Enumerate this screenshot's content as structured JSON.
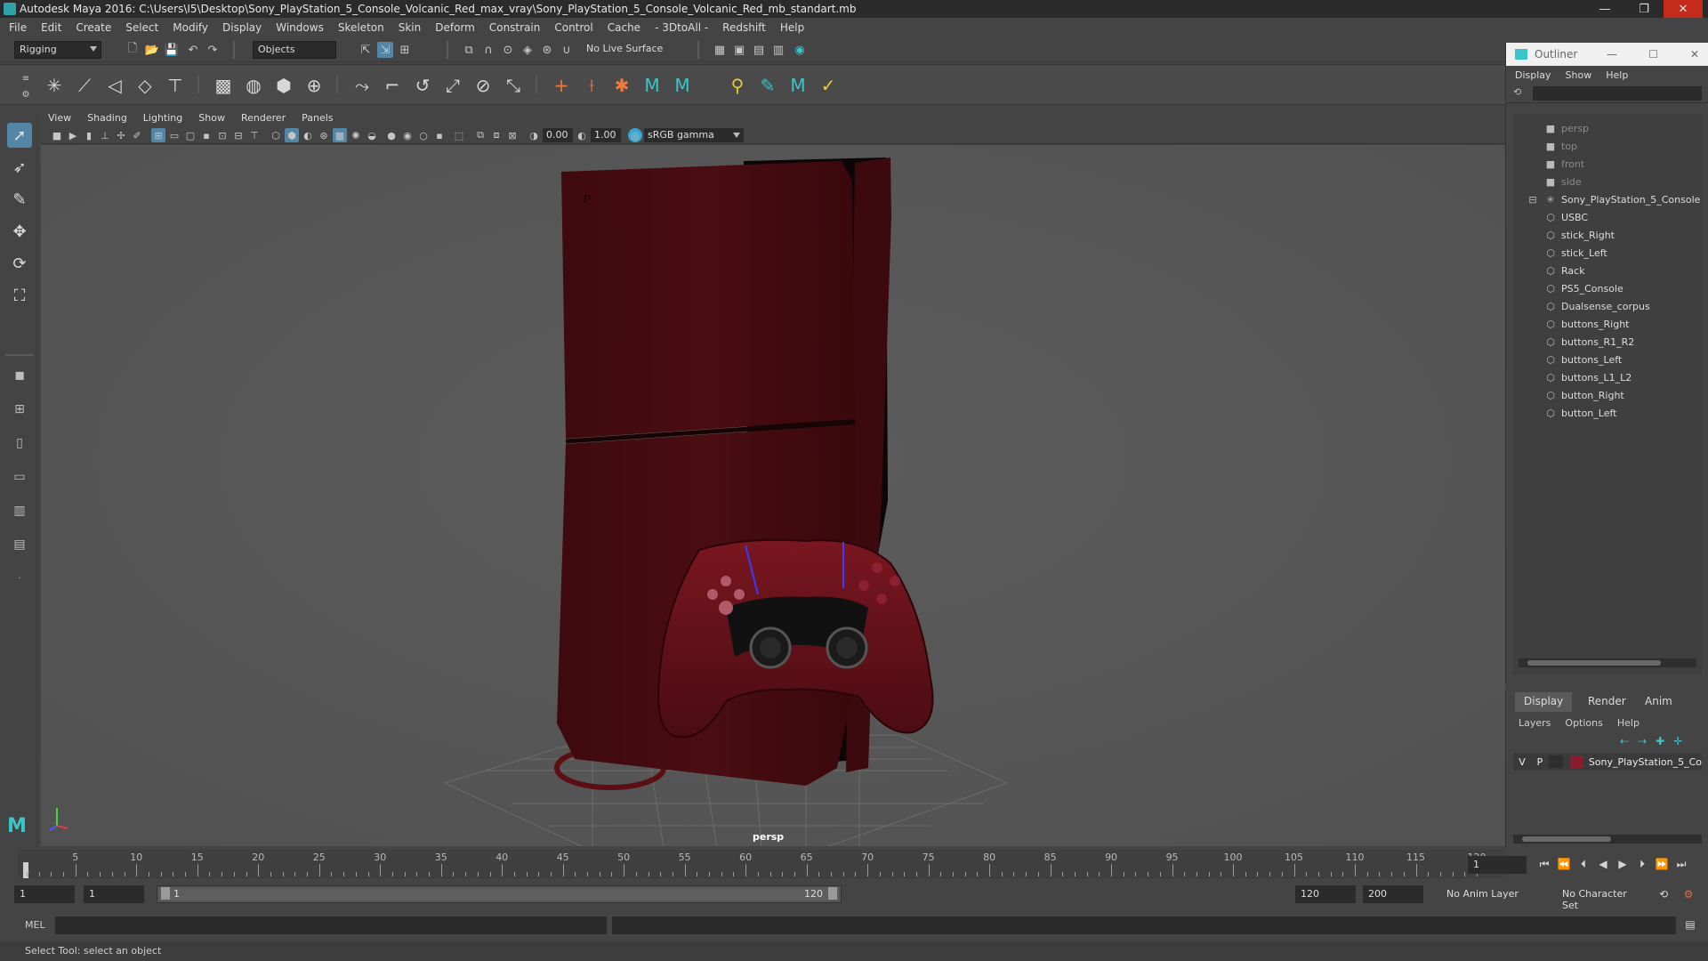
{
  "window": {
    "title": "Autodesk Maya 2016: C:\\Users\\I5\\Desktop\\Sony_PlayStation_5_Console_Volcanic_Red_max_vray\\Sony_PlayStation_5_Console_Volcanic_Red_mb_standart.mb",
    "min": "—",
    "max": "❐",
    "close": "✕"
  },
  "menubar": [
    "File",
    "Edit",
    "Create",
    "Select",
    "Modify",
    "Display",
    "Windows",
    "Skeleton",
    "Skin",
    "Deform",
    "Constrain",
    "Control",
    "Cache",
    "- 3DtoAll -",
    "Redshift",
    "Help"
  ],
  "statusline": {
    "mode": "Rigging",
    "selection_mode": "Objects",
    "live_surface": "No Live Surface"
  },
  "panel": {
    "menu": [
      "View",
      "Shading",
      "Lighting",
      "Show",
      "Renderer",
      "Panels"
    ],
    "exposure": "0.00",
    "gamma": "1.00",
    "color_space": "sRGB gamma",
    "camera_label": "persp"
  },
  "outliner": {
    "title": "Outliner",
    "menu": [
      "Display",
      "Show",
      "Help"
    ],
    "items": [
      {
        "label": "persp",
        "kind": "camera"
      },
      {
        "label": "top",
        "kind": "camera"
      },
      {
        "label": "front",
        "kind": "camera"
      },
      {
        "label": "side",
        "kind": "camera"
      },
      {
        "label": "Sony_PlayStation_5_Console",
        "kind": "group"
      },
      {
        "label": "USBC",
        "kind": "mesh"
      },
      {
        "label": "stick_Right",
        "kind": "mesh"
      },
      {
        "label": "stick_Left",
        "kind": "mesh"
      },
      {
        "label": "Rack",
        "kind": "mesh"
      },
      {
        "label": "PS5_Console",
        "kind": "mesh"
      },
      {
        "label": "Dualsense_corpus",
        "kind": "mesh"
      },
      {
        "label": "buttons_Right",
        "kind": "mesh"
      },
      {
        "label": "buttons_R1_R2",
        "kind": "mesh"
      },
      {
        "label": "buttons_Left",
        "kind": "mesh"
      },
      {
        "label": "buttons_L1_L2",
        "kind": "mesh"
      },
      {
        "label": "button_Right",
        "kind": "mesh"
      },
      {
        "label": "button_Left",
        "kind": "mesh"
      }
    ]
  },
  "layer_editor": {
    "tabs": [
      "Display",
      "Render",
      "Anim"
    ],
    "menu": [
      "Layers",
      "Options",
      "Help"
    ],
    "layer": {
      "v": "V",
      "p": "P",
      "name": "Sony_PlayStation_5_Co",
      "color": "#8b1c2e"
    }
  },
  "timeline": {
    "ticks": [
      "5",
      "10",
      "15",
      "20",
      "25",
      "30",
      "35",
      "40",
      "45",
      "50",
      "55",
      "60",
      "65",
      "70",
      "75",
      "80",
      "85",
      "90",
      "95",
      "100",
      "105",
      "110",
      "115",
      "120"
    ],
    "start_label": "1",
    "current_frame": "1"
  },
  "range": {
    "start": "1",
    "playback_start": "1",
    "range_start": "1",
    "range_end": "120",
    "playback_end": "120",
    "end": "200",
    "anim_layer": "No Anim Layer",
    "character_set": "No Character Set"
  },
  "command": {
    "language": "MEL",
    "help_text": "Select Tool: select an object"
  }
}
